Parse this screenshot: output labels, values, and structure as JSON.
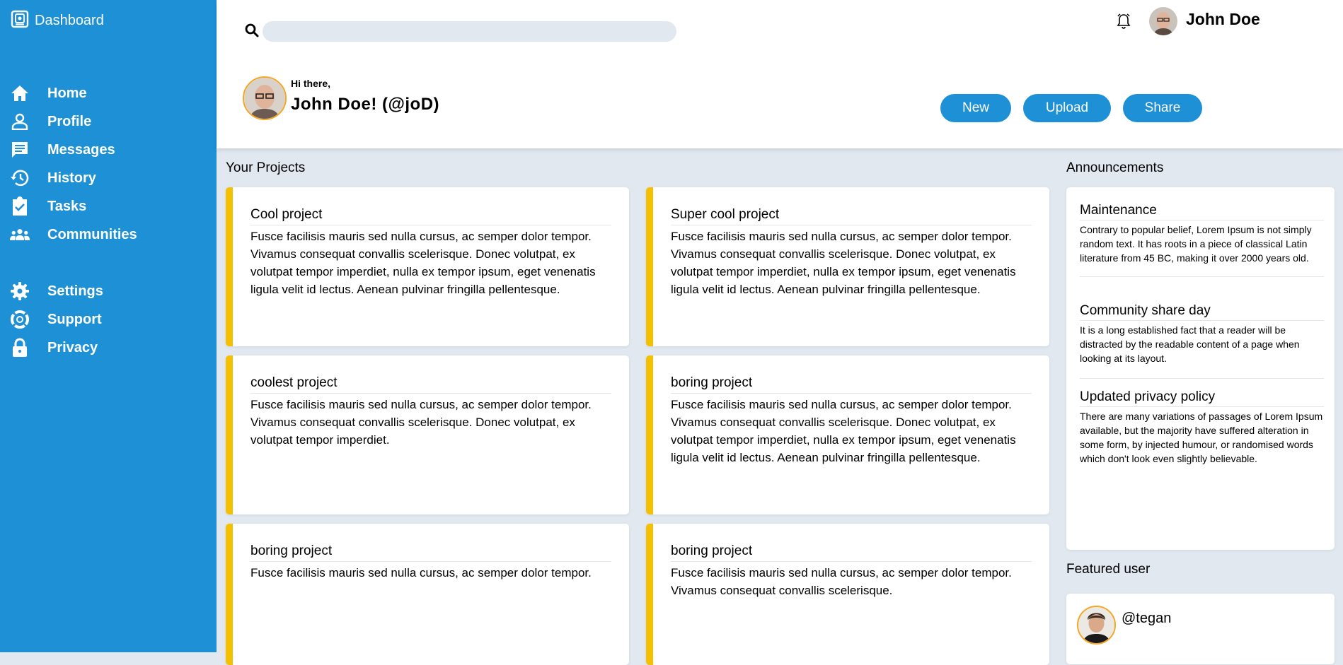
{
  "sidebar": {
    "brand": "Dashboard",
    "items": [
      {
        "label": "Home",
        "icon": "home-icon"
      },
      {
        "label": "Profile",
        "icon": "user-icon"
      },
      {
        "label": "Messages",
        "icon": "message-icon"
      },
      {
        "label": "History",
        "icon": "history-icon"
      },
      {
        "label": "Tasks",
        "icon": "clipboard-check-icon"
      },
      {
        "label": "Communities",
        "icon": "users-icon"
      },
      {
        "label": "Settings",
        "icon": "gear-icon"
      },
      {
        "label": "Support",
        "icon": "lifebuoy-icon"
      },
      {
        "label": "Privacy",
        "icon": "lock-icon"
      }
    ]
  },
  "header": {
    "search": {
      "placeholder": "",
      "value": ""
    },
    "user_name": "John Doe",
    "greeting": "Hi there,",
    "greeting_name": "John Doe! (@joD)",
    "buttons": {
      "new": "New",
      "upload": "Upload",
      "share": "Share"
    }
  },
  "projects": {
    "title": "Your Projects",
    "items": [
      {
        "title": "Cool project",
        "body": "Fusce facilisis mauris sed nulla cursus, ac semper dolor tempor. Vivamus consequat convallis scelerisque. Donec volutpat, ex volutpat tempor imperdiet, nulla ex tempor ipsum, eget venenatis ligula velit id lectus. Aenean pulvinar fringilla pellentesque."
      },
      {
        "title": "Super cool project",
        "body": "Fusce facilisis mauris sed nulla cursus, ac semper dolor tempor. Vivamus consequat convallis scelerisque. Donec volutpat, ex volutpat tempor imperdiet, nulla ex tempor ipsum, eget venenatis ligula velit id lectus. Aenean pulvinar fringilla pellentesque."
      },
      {
        "title": "coolest project",
        "body": "Fusce facilisis mauris sed nulla cursus, ac semper dolor tempor. Vivamus consequat convallis scelerisque. Donec volutpat, ex volutpat tempor imperdiet."
      },
      {
        "title": "boring project",
        "body": "Fusce facilisis mauris sed nulla cursus, ac semper dolor tempor. Vivamus consequat convallis scelerisque. Donec volutpat, ex volutpat tempor imperdiet, nulla ex tempor ipsum, eget venenatis ligula velit id lectus. Aenean pulvinar fringilla pellentesque."
      },
      {
        "title": "boring project",
        "body": "Fusce facilisis mauris sed nulla cursus, ac semper dolor tempor."
      },
      {
        "title": "boring project",
        "body": "Fusce facilisis mauris sed nulla cursus, ac semper dolor tempor. Vivamus consequat convallis scelerisque."
      }
    ]
  },
  "announcements": {
    "title": "Announcements",
    "items": [
      {
        "title": "Maintenance",
        "body": "Contrary to popular belief, Lorem Ipsum is not simply random text. It has roots in a piece of classical Latin literature from 45 BC, making it over 2000 years old."
      },
      {
        "title": "Community share day",
        "body": "It is a long established fact that a reader will be distracted by the readable content of a page when looking at its layout."
      },
      {
        "title": "Updated privacy policy",
        "body": "There are many variations of passages of Lorem Ipsum available, but the majority have suffered alteration in some form, by injected humour, or randomised words which don't look even slightly believable."
      }
    ]
  },
  "featured": {
    "title": "Featured user",
    "handle": "@tegan"
  },
  "colors": {
    "sidebar": "#1e90d6",
    "accent_bar": "#f5c000",
    "avatar_ring": "#f5a623",
    "background": "#e2e8f0"
  }
}
